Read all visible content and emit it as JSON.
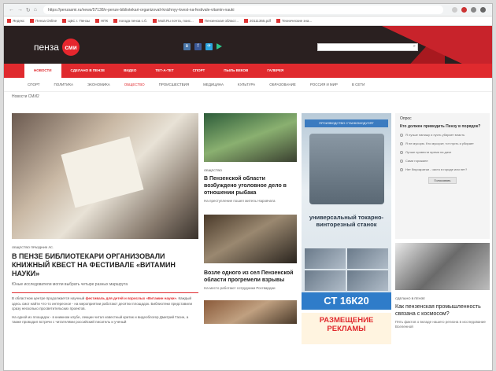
{
  "browser": {
    "url": "https://penzasmi.ru/news/57138/v-penze-bibliotekari-organizovali-knizhnyy-kvest-na-festivale-vitamin-nauki",
    "bookmarks": [
      "Яндекс",
      "Пенза Online",
      "ЦБС г. Пензы",
      "НПК",
      "погода пенза с.б.",
      "Мой.Ru почта, поис...",
      "Пензенская област...",
      "20111365.pdf",
      "Технические зна..."
    ]
  },
  "header": {
    "logo_text": "пенза",
    "logo_badge": "сми",
    "search_placeholder": ""
  },
  "main_nav": [
    "НОВОСТИ",
    "СДЕЛАНО В ПЕНЗЕ",
    "ВИДЕО",
    "ТЕТ-А-ТЕТ",
    "СПОРТ",
    "ПЫЛЬ ВЕКОВ",
    "ГАЛЕРЕЯ"
  ],
  "sub_nav": [
    "СПОРТ",
    "ПОЛИТИКА",
    "ЭКОНОМИКА",
    "ОБЩЕСТВО",
    "ПРОИСШЕСТВИЯ",
    "МЕДИЦИНА",
    "КУЛЬТУРА",
    "ОБРАЗОВАНИЕ",
    "РОССИЯ И МИР",
    "В СЕТИ"
  ],
  "breadcrumb": "Новости СМИ2",
  "lead_article": {
    "tags": "общество   праздник лс.",
    "title": "В ПЕНЗЕ БИБЛИОТЕКАРИ ОРГАНИЗОВАЛИ КНИЖНЫЙ КВЕСТ НА ФЕСТИВАЛЕ «ВИТАМИН НАУКИ»",
    "lead": "Юные исследователи могли выбрать четыре разных маршрута",
    "body1_pre": "В областном центре продолжается научный ",
    "body1_hl": "фестиваль для детей и взрослых «Витамин науки»",
    "body1_post": ". Каждый здесь смог найти что-то интересное - на мероприятии работают десятки площадок. Библиотеки представили сразу несколько просветительских проектов.",
    "body2": "На одной из площадок - в книжном клубе, лекции читал известный критик и видеоблогер Дмитрий Гасин, а также проводил встречи с читателями российский писатель и ученый"
  },
  "col2": [
    {
      "tag": "общество",
      "title": "В Пензенской области возбуждено уголовное дело в отношении рыбака",
      "sub": "На преступление пошел житель Наровчата"
    },
    {
      "tag": "",
      "title": "Возле одного из сел Пензенской области прогремели взрывы",
      "sub": "На место работают сотрудники Росгвардии"
    }
  ],
  "ad": {
    "banner": "ПРОИЗВОДСТВО СТАНКОМОДУЛЯТ",
    "headline": "универсальный токарно-винторезный станок",
    "model": "СТ 16К20",
    "ad2": "РАЗМЕЩЕНИЕ РЕКЛАМЫ"
  },
  "poll": {
    "header": "Опрос",
    "question": "Кто должен приводить Пензу в порядок?",
    "options": [
      "Я лучше напишу и пусть убирает власть",
      "Я не мусорю. Кто мусорит, тот пусть и убирает",
      "Лучше провести время на даче",
      "Сами горожане",
      "Нет бюрократии - чисто в городе или нет?"
    ],
    "vote": "Голосовать"
  },
  "col4_article": {
    "tag": "Сделано в Пензе",
    "title": "Как пензенская промышленность связана с космосом?",
    "sub": "Пять фактов о вкладе нашего региона в исследование Вселенной"
  }
}
